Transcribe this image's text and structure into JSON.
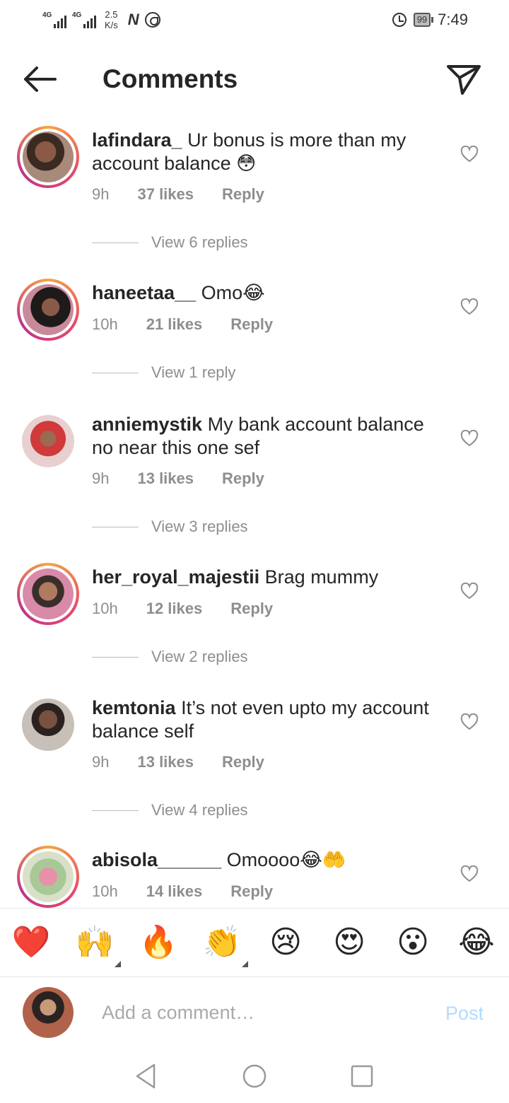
{
  "status_bar": {
    "network1": "4G",
    "network2": "4G",
    "speed_value": "2.5",
    "speed_unit": "K/s",
    "battery": "99",
    "time": "7:49"
  },
  "header": {
    "title": "Comments"
  },
  "comments": [
    {
      "username": "lafindara_",
      "text": "Ur bonus is more than my account balance 😳",
      "time": "9h",
      "likes": "37 likes",
      "reply": "Reply",
      "view_replies": "View 6 replies"
    },
    {
      "username": "haneetaa__",
      "text": "Omo😂",
      "time": "10h",
      "likes": "21 likes",
      "reply": "Reply",
      "view_replies": "View 1 reply"
    },
    {
      "username": "anniemystik",
      "text": "My bank account balance no near this one sef",
      "time": "9h",
      "likes": "13 likes",
      "reply": "Reply",
      "view_replies": "View 3 replies"
    },
    {
      "username": "her_royal_majestii",
      "text": "Brag mummy",
      "time": "10h",
      "likes": "12 likes",
      "reply": "Reply",
      "view_replies": "View 2 replies"
    },
    {
      "username": "kemtonia",
      "text": "It’s not even upto my account balance self",
      "time": "9h",
      "likes": "13 likes",
      "reply": "Reply",
      "view_replies": "View 4 replies"
    },
    {
      "username": "abisola______",
      "text": "Omoooo😂🤲",
      "time": "10h",
      "likes": "14 likes",
      "reply": "Reply"
    }
  ],
  "emoji_bar": [
    "❤️",
    "🙌",
    "🔥",
    "👏",
    "😢",
    "😍",
    "😮",
    "😂"
  ],
  "composer": {
    "placeholder": "Add a comment…",
    "post_label": "Post"
  },
  "colors": {
    "text": "#262626",
    "meta": "#8e8e8e",
    "post": "#b3dbff",
    "story_ring_start": "#f5a442",
    "story_ring_end": "#c0338b"
  }
}
